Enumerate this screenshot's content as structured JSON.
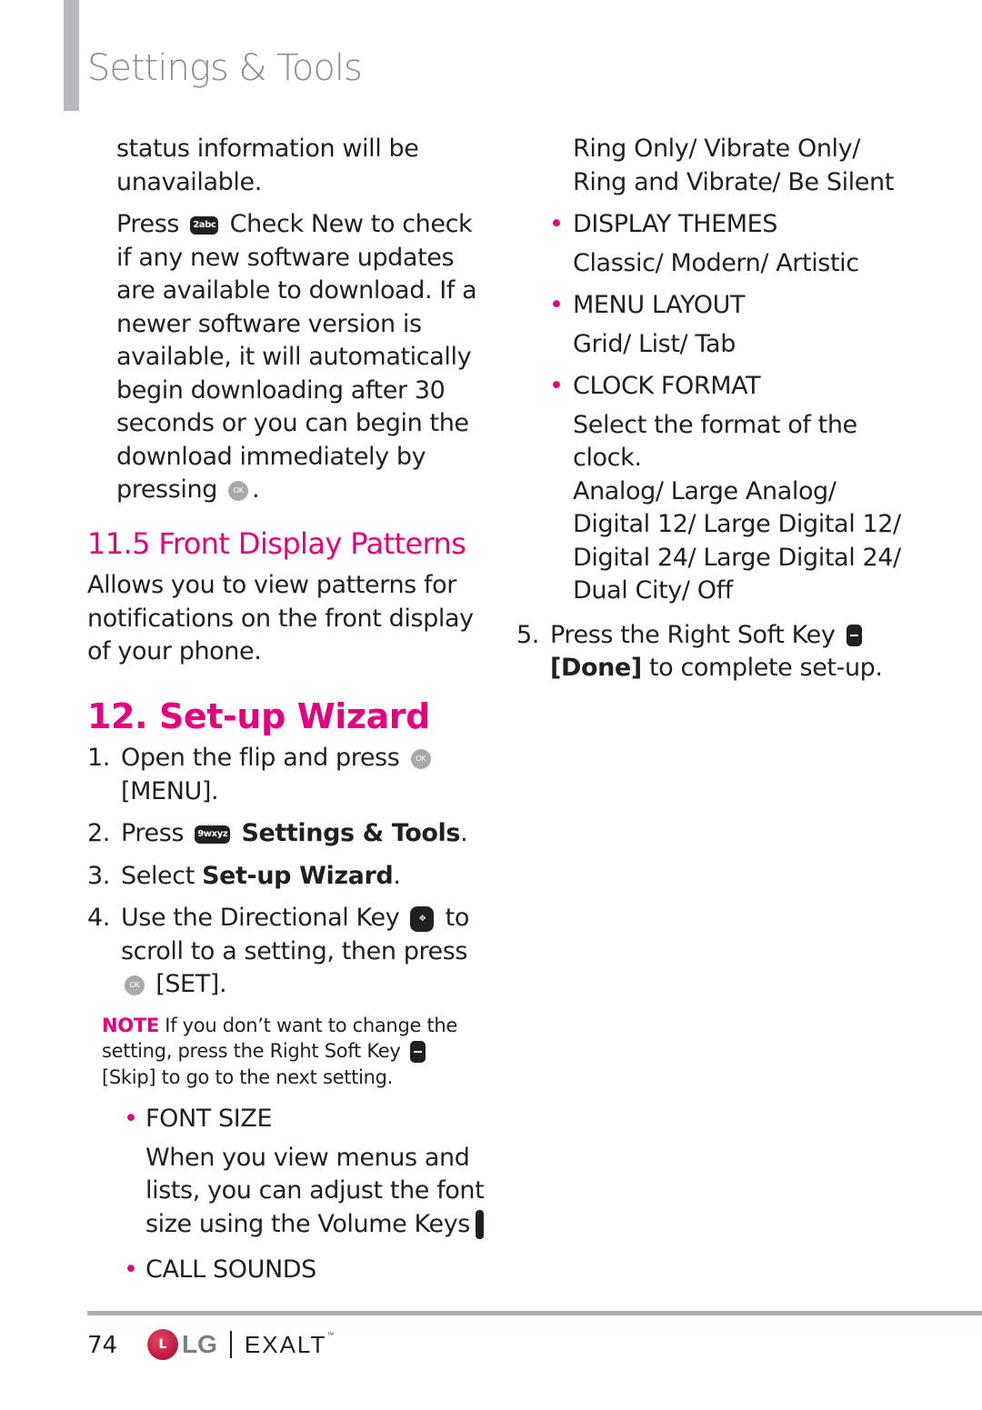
{
  "header": {
    "title": "Settings & Tools"
  },
  "left": {
    "intro_line": "status information will be unavailable.",
    "check_new": {
      "press": "Press",
      "key_label": "2abc",
      "text": "Check New to check if any new software updates are available to download. If a newer software version is available, it will automatically begin downloading after 30 seconds or you can begin the download immediately by pressing",
      "ok_label": "OK",
      "end": "."
    },
    "section_11_5": {
      "heading": "11.5 Front Display Patterns",
      "body": "Allows you to view patterns for notifications on the front display of your phone."
    },
    "section_12": {
      "heading": "12. Set-up Wizard",
      "steps": [
        {
          "num": "1.",
          "text": "Open the flip and press",
          "ok_label": "OK",
          "tail": "[MENU]."
        },
        {
          "num": "2.",
          "pre": "Press",
          "key_label": "9wxyz",
          "bold": "Settings & Tools",
          "end": "."
        },
        {
          "num": "3.",
          "pre": "Select",
          "bold": "Set-up Wizard",
          "end": "."
        },
        {
          "num": "4.",
          "pre": "Use the Directional Key",
          "post": "to scroll to a setting, then press",
          "ok_label": "OK",
          "tail": "[SET]."
        }
      ],
      "note": {
        "tag": "NOTE",
        "text": "If you don’t want to change the setting, press the Right Soft Key",
        "bold": "[Skip]",
        "tail": "to go to the next setting."
      },
      "bullets": [
        {
          "label": "FONT SIZE",
          "desc": "When you view menus and lists, you can adjust the font size using the Volume Keys"
        },
        {
          "label": "CALL SOUNDS"
        }
      ]
    }
  },
  "right": {
    "call_sounds_options": "Ring Only/ Vibrate Only/ Ring and Vibrate/ Be Silent",
    "bullets": [
      {
        "label": "DISPLAY THEMES",
        "desc": "Classic/ Modern/ Artistic"
      },
      {
        "label": "MENU LAYOUT",
        "desc": "Grid/ List/ Tab"
      },
      {
        "label": "CLOCK FORMAT",
        "desc": "Select the format of the clock.",
        "options": "Analog/ Large Analog/ Digital 12/ Large Digital 12/ Digital 24/ Large Digital 24/ Dual City/ Off"
      }
    ],
    "step5": {
      "num": "5.",
      "text": "Press the Right Soft Key",
      "bold": "[Done]",
      "tail": "to complete set-up."
    }
  },
  "footer": {
    "page_number": "74",
    "brand": "LG",
    "brand_circle": "L",
    "product": "EXALT",
    "tm": "™"
  },
  "colors": {
    "accent": "#e4007f",
    "text": "#231f20",
    "title_gray": "#8a8c8f",
    "rule_gray": "#aaaeb1"
  }
}
